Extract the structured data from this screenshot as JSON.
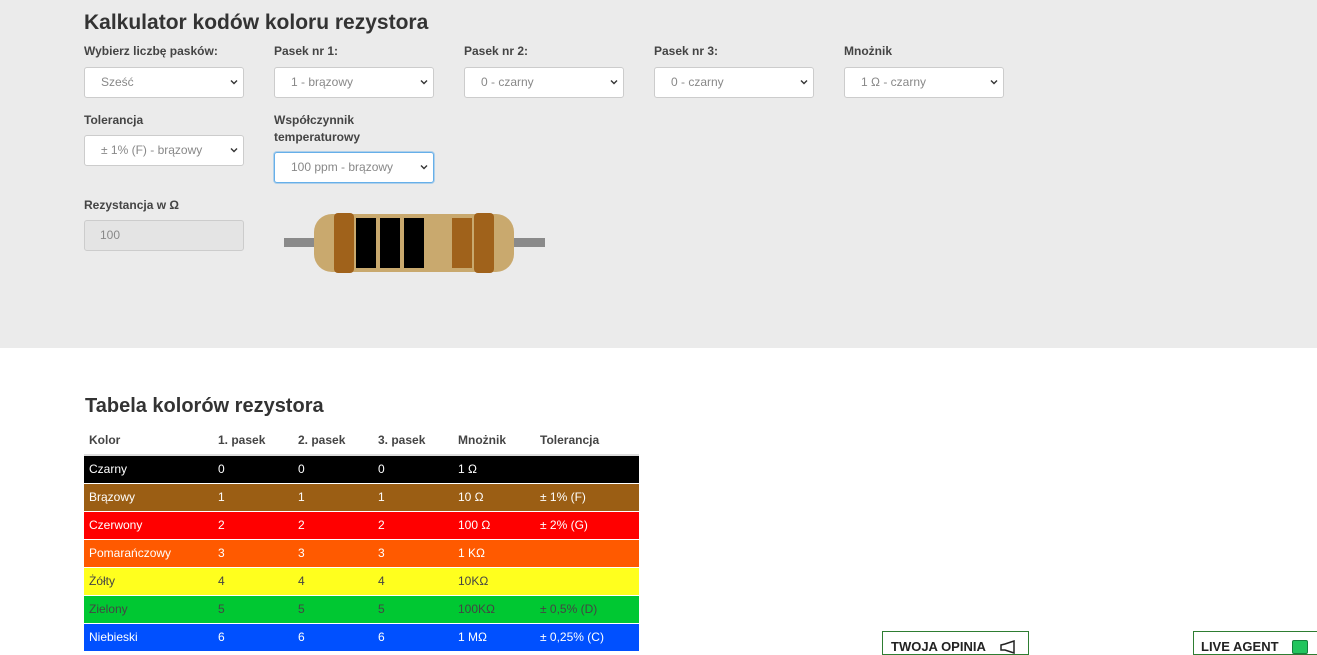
{
  "calculator": {
    "title": "Kalkulator kodów koloru rezystora",
    "fields": {
      "bands_count": {
        "label": "Wybierz liczbę pasków:",
        "value": "Sześć"
      },
      "band1": {
        "label": "Pasek nr 1:",
        "value": "1 - brązowy"
      },
      "band2": {
        "label": "Pasek nr 2:",
        "value": "0 - czarny"
      },
      "band3": {
        "label": "Pasek nr 3:",
        "value": "0 - czarny"
      },
      "multiplier": {
        "label": "Mnożnik",
        "value": "1 Ω - czarny"
      },
      "tolerance": {
        "label": "Tolerancja",
        "value": "± 1% (F) - brązowy"
      },
      "tempco": {
        "label": "Współczynnik temperaturowy",
        "value": "100 ppm - brązowy"
      }
    },
    "resistance": {
      "label": "Rezystancja w Ω",
      "value": "100"
    },
    "resistor_bands": [
      "brown",
      "black",
      "black",
      "black",
      "brown",
      "brown"
    ],
    "colors": {
      "lead": "#8a8a8a",
      "body": "#c9a96e",
      "brown": "#a0621b",
      "black": "#000000"
    }
  },
  "color_table": {
    "title": "Tabela kolorów rezystora",
    "headers": [
      "Kolor",
      "1. pasek",
      "2. pasek",
      "3. pasek",
      "Mnożnik",
      "Tolerancja"
    ],
    "rows": [
      {
        "cells": [
          "Czarny",
          "0",
          "0",
          "0",
          "1 Ω",
          ""
        ],
        "bg": "#000000",
        "fg": "#ffffff"
      },
      {
        "cells": [
          "Brązowy",
          "1",
          "1",
          "1",
          "10 Ω",
          "± 1% (F)"
        ],
        "bg": "#9b5e14",
        "fg": "#ffffff"
      },
      {
        "cells": [
          "Czerwony",
          "2",
          "2",
          "2",
          "100 Ω",
          "± 2% (G)"
        ],
        "bg": "#ff0000",
        "fg": "#ffffff"
      },
      {
        "cells": [
          "Pomarańczowy",
          "3",
          "3",
          "3",
          "1 KΩ",
          ""
        ],
        "bg": "#ff5a00",
        "fg": "#ffffff"
      },
      {
        "cells": [
          "Żółty",
          "4",
          "4",
          "4",
          "10KΩ",
          ""
        ],
        "bg": "#ffff1e",
        "fg": "#444444"
      },
      {
        "cells": [
          "Zielony",
          "5",
          "5",
          "5",
          "100KΩ",
          "± 0,5% (D)"
        ],
        "bg": "#00c832",
        "fg": "#444444"
      },
      {
        "cells": [
          "Niebieski",
          "6",
          "6",
          "6",
          "1 MΩ",
          "± 0,25% (C)"
        ],
        "bg": "#0050ff",
        "fg": "#ffffff"
      }
    ]
  },
  "footer_buttons": {
    "feedback": "TWOJA OPINIA",
    "live_agent": "LIVE AGENT"
  }
}
